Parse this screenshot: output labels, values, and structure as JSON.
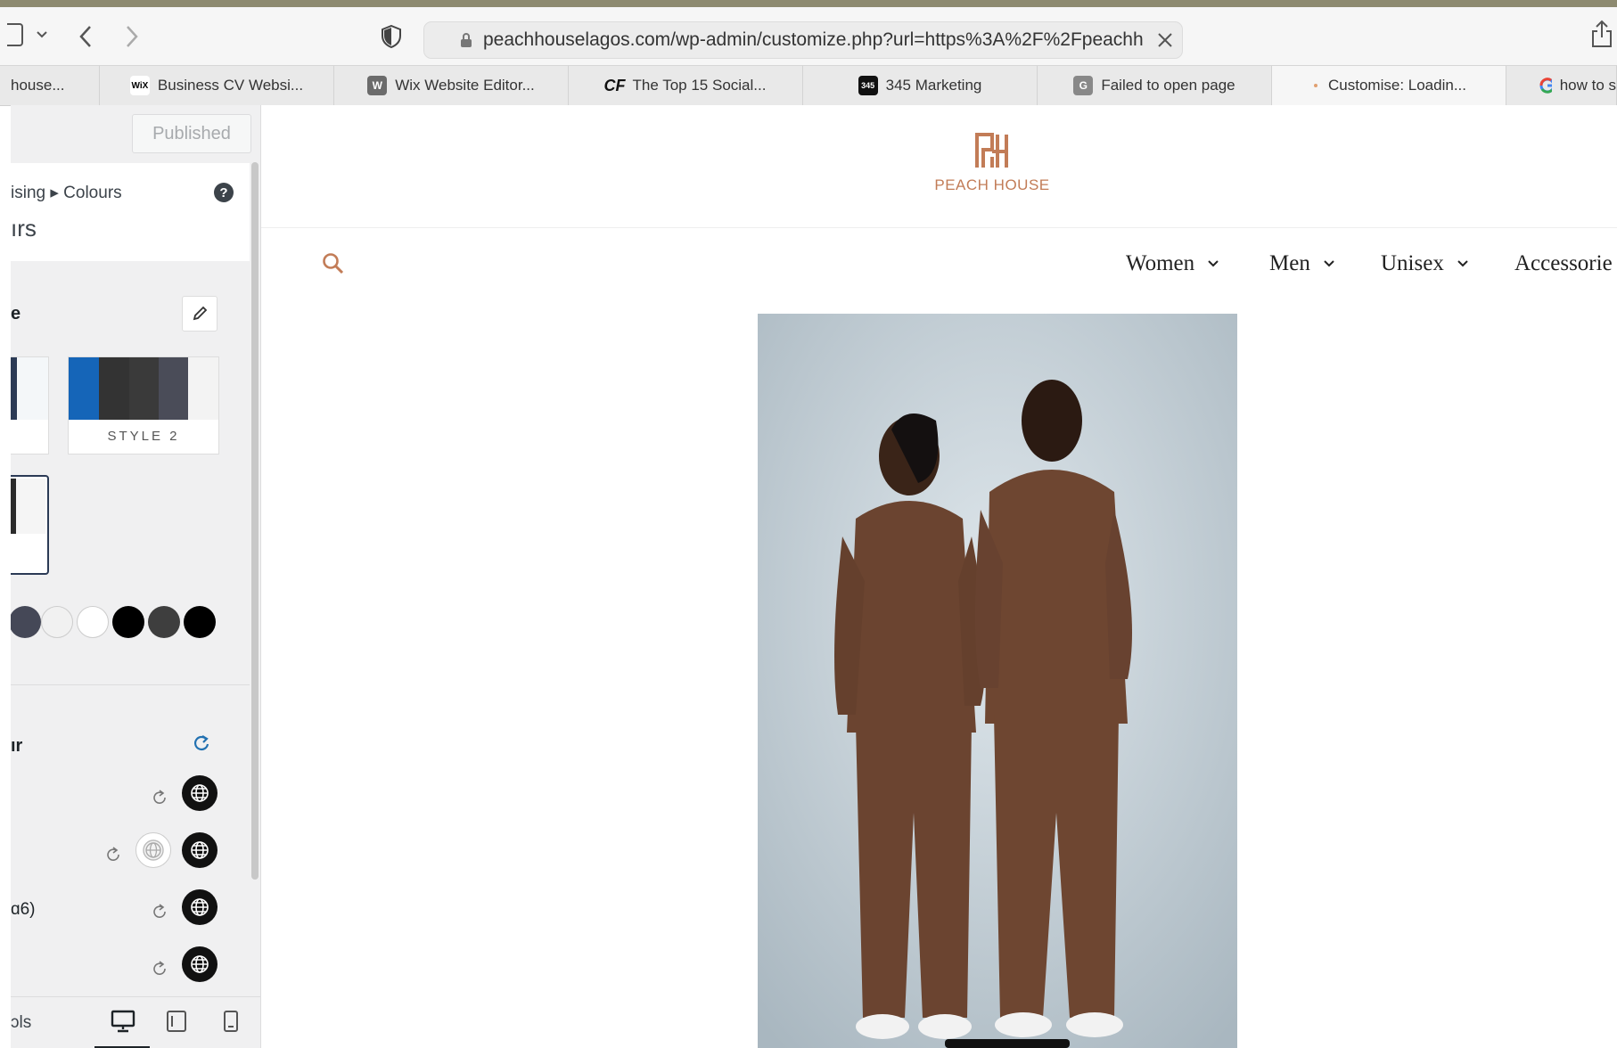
{
  "browser": {
    "url": "peachhouselagos.com/wp-admin/customize.php?url=https%3A%2F%2Fpeachhou",
    "tabs": [
      {
        "label": "house..."
      },
      {
        "label": "Business CV Websi...",
        "icon": "wix-icon",
        "icon_text": "WiX"
      },
      {
        "label": "Wix Website Editor...",
        "icon": "w-icon",
        "icon_text": "W"
      },
      {
        "label": "The Top 15 Social...",
        "icon": "cf-icon",
        "icon_text": "CF"
      },
      {
        "label": "345 Marketing",
        "icon": "345-icon",
        "icon_text": "345"
      },
      {
        "label": "Failed to open page",
        "icon": "g-letter-icon",
        "icon_text": "G"
      },
      {
        "label": "Customise: Loadin...",
        "icon": "loading-icon"
      },
      {
        "label": "how to s",
        "icon": "google-icon"
      }
    ]
  },
  "customizer": {
    "publish_label": "Published",
    "breadcrumb": "ising ▸ Colours",
    "section_title": "ırs",
    "palette_heading": "e",
    "style2_label": "STYLE 2",
    "colour_heading": "ır",
    "row_label_h6": "ɑ6)",
    "footer_label": "ɔls",
    "palette_colors": [
      "#454857",
      "#f1f1f1",
      "#ffffff",
      "#000000",
      "#3e3e3e",
      "#000000"
    ],
    "style2_colors": [
      "#1565b8",
      "#333333",
      "#3a3a3a",
      "#4a4c58",
      "#f3f3f3"
    ]
  },
  "site": {
    "logo_text": "PEACH HOUSE",
    "nav": [
      {
        "label": "Women"
      },
      {
        "label": "Men"
      },
      {
        "label": "Unisex"
      },
      {
        "label": "Accessorie"
      }
    ],
    "accent_color": "#c27c57"
  }
}
